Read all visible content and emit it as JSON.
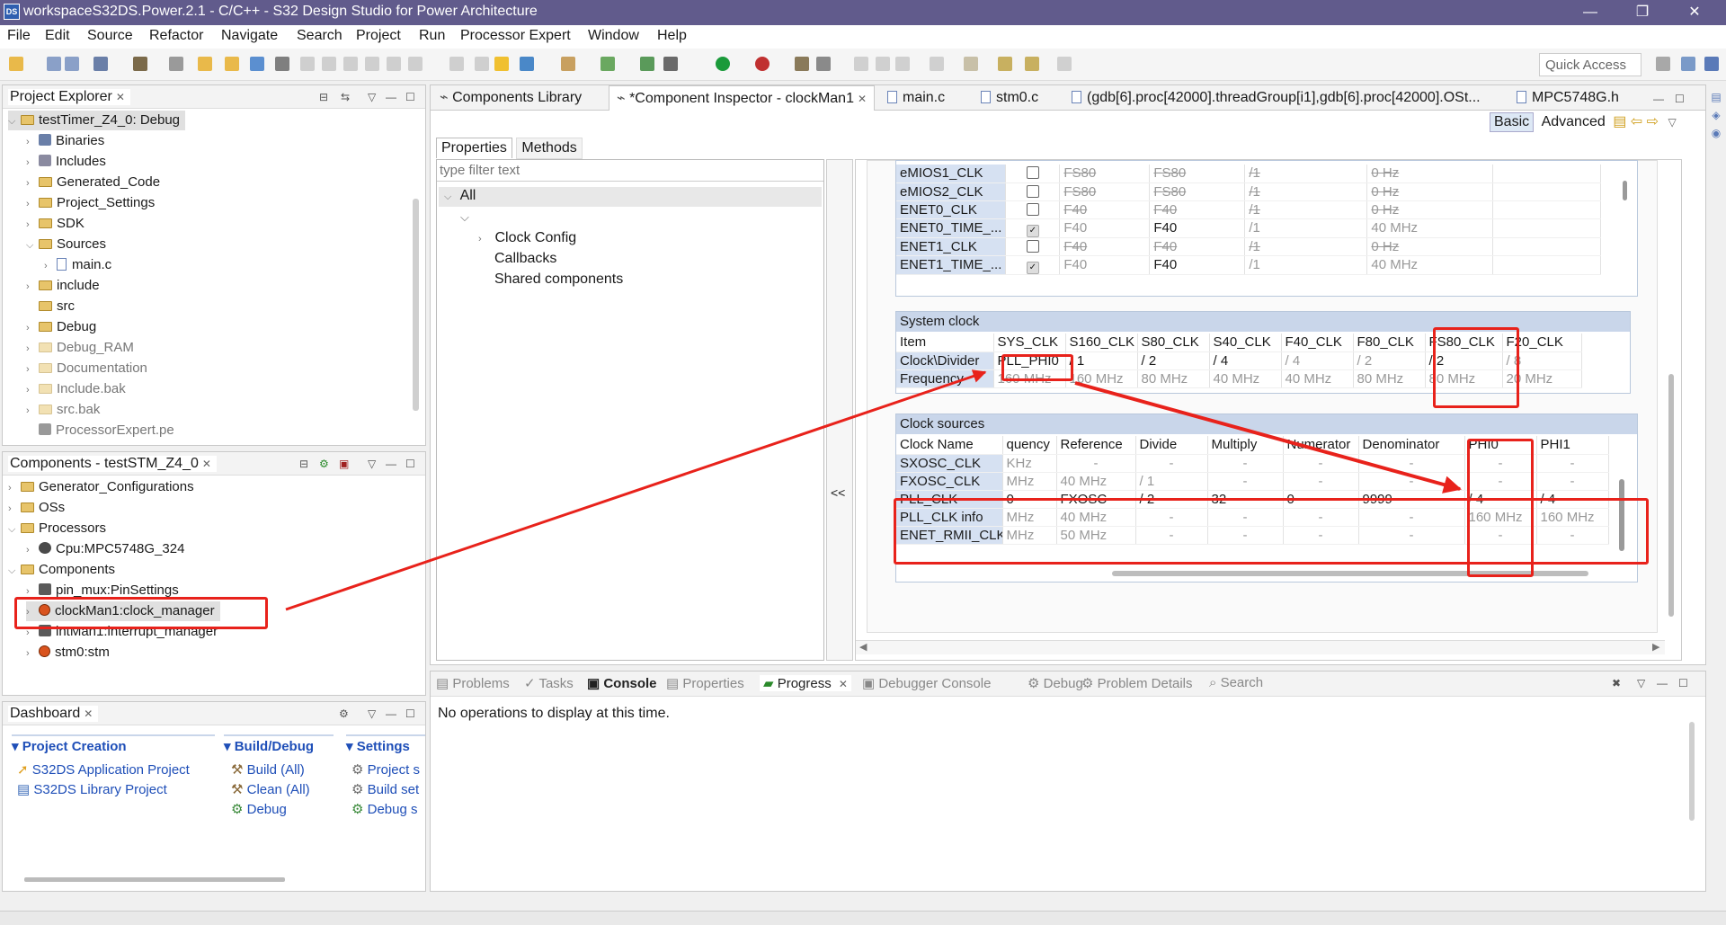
{
  "window": {
    "title": "workspaceS32DS.Power.2.1 - C/C++ - S32 Design Studio for Power Architecture",
    "minimize": "—",
    "restore": "❐",
    "close": "✕"
  },
  "menu": [
    "File",
    "Edit",
    "Source",
    "Refactor",
    "Navigate",
    "Search",
    "Project",
    "Run",
    "Processor Expert",
    "Window",
    "Help"
  ],
  "toolbar": {
    "quick_access": "Quick Access"
  },
  "project_explorer": {
    "title": "Project Explorer",
    "root": "testTimer_Z4_0: Debug",
    "items": [
      "Binaries",
      "Includes",
      "Generated_Code",
      "Project_Settings",
      "SDK",
      "Sources",
      "main.c",
      "include",
      "src",
      "Debug",
      "Debug_RAM",
      "Documentation",
      "Include.bak",
      "src.bak",
      "ProcessorExpert.pe"
    ]
  },
  "components": {
    "title": "Components - testSTM_Z4_0",
    "items": [
      "Generator_Configurations",
      "OSs",
      "Processors",
      "Cpu:MPC5748G_324",
      "Components",
      "pin_mux:PinSettings",
      "clockMan1:clock_manager",
      "intMan1:interrupt_manager",
      "stm0:stm"
    ]
  },
  "dashboard": {
    "title": "Dashboard",
    "groups": [
      {
        "title": "Project Creation",
        "links": [
          "S32DS Application Project",
          "S32DS Library Project"
        ]
      },
      {
        "title": "Build/Debug",
        "links": [
          "Build  (All)",
          "Clean  (All)",
          "Debug"
        ]
      },
      {
        "title": "Settings",
        "links": [
          "Project s",
          "Build set",
          "Debug s"
        ]
      }
    ]
  },
  "editor_tabs": [
    "Components Library",
    "*Component Inspector - clockMan1",
    "main.c",
    "stm0.c",
    "(gdb[6].proc[42000].threadGroup[i1],gdb[6].proc[42000].OSt...",
    "MPC5748G.h"
  ],
  "inspector": {
    "mode_basic": "Basic",
    "mode_advanced": "Advanced",
    "tab_properties": "Properties",
    "tab_methods": "Methods",
    "filter_placeholder": "type filter text",
    "tree_all": "All",
    "tree_items": [
      "Clock Config",
      "Callbacks",
      "Shared components"
    ],
    "collapse": "<<"
  },
  "peripheral_rows": [
    {
      "name": "eMIOS1_CLK",
      "checked": false,
      "src": "FS80",
      "src2": "FS80",
      "div": "/1",
      "freq": "0 Hz",
      "active": false
    },
    {
      "name": "eMIOS2_CLK",
      "checked": false,
      "src": "FS80",
      "src2": "FS80",
      "div": "/1",
      "freq": "0 Hz",
      "active": false
    },
    {
      "name": "ENET0_CLK",
      "checked": false,
      "src": "F40",
      "src2": "F40",
      "div": "/1",
      "freq": "0 Hz",
      "active": false
    },
    {
      "name": "ENET0_TIME_...",
      "checked": true,
      "src": "F40",
      "src2": "F40",
      "div": "/1",
      "freq": "40 MHz",
      "active": true
    },
    {
      "name": "ENET1_CLK",
      "checked": false,
      "src": "F40",
      "src2": "F40",
      "div": "/1",
      "freq": "0 Hz",
      "active": false
    },
    {
      "name": "ENET1_TIME_...",
      "checked": true,
      "src": "F40",
      "src2": "F40",
      "div": "/1",
      "freq": "40 MHz",
      "active": true
    }
  ],
  "system_clock": {
    "title": "System clock",
    "item_label": "Item",
    "row_divider": "Clock\\Divider",
    "row_frequency": "Frequency",
    "columns": [
      "SYS_CLK",
      "S160_CLK",
      "S80_CLK",
      "S40_CLK",
      "F40_CLK",
      "F80_CLK",
      "FS80_CLK",
      "F20_CLK"
    ],
    "dividers": [
      "PLL_PHI0",
      "/ 1",
      "/ 2",
      "/ 4",
      "/ 4",
      "/ 2",
      "/ 2",
      "/ 8"
    ],
    "frequencies": [
      "160 MHz",
      "160 MHz",
      "80 MHz",
      "40 MHz",
      "40 MHz",
      "80 MHz",
      "80 MHz",
      "20 MHz"
    ]
  },
  "clock_sources": {
    "title": "Clock sources",
    "headers": [
      "Clock Name",
      "quency",
      "Reference",
      "Divide",
      "Multiply",
      "Numerator",
      "Denominator",
      "PHI0",
      "PHI1"
    ],
    "rows": [
      [
        "SXOSC_CLK",
        "KHz",
        "-",
        "-",
        "-",
        "-",
        "-",
        "-",
        "-"
      ],
      [
        "FXOSC_CLK",
        "MHz",
        "40 MHz",
        "/ 1",
        "-",
        "-",
        "-",
        "-",
        "-"
      ],
      [
        "PLL_CLK",
        "0",
        "FXOSC",
        "/ 2",
        "32",
        "0",
        "9999",
        "/ 4",
        "/ 4"
      ],
      [
        "PLL_CLK info",
        "MHz",
        "40 MHz",
        "-",
        "-",
        "-",
        "-",
        "160 MHz",
        "160 MHz"
      ],
      [
        "ENET_RMII_CLK",
        "MHz",
        "50 MHz",
        "-",
        "-",
        "-",
        "-",
        "-",
        "-"
      ]
    ]
  },
  "bottom": {
    "tabs": [
      "Problems",
      "Tasks",
      "Console",
      "Properties",
      "Progress",
      "Debugger Console",
      "Debug",
      "Problem Details",
      "Search"
    ],
    "message": "No operations to display at this time."
  },
  "colors": {
    "title_bar": "#615b8c",
    "annotation_red": "#e8221b",
    "section_header": "#c9d6ea",
    "link_blue": "#1f4fb8"
  }
}
